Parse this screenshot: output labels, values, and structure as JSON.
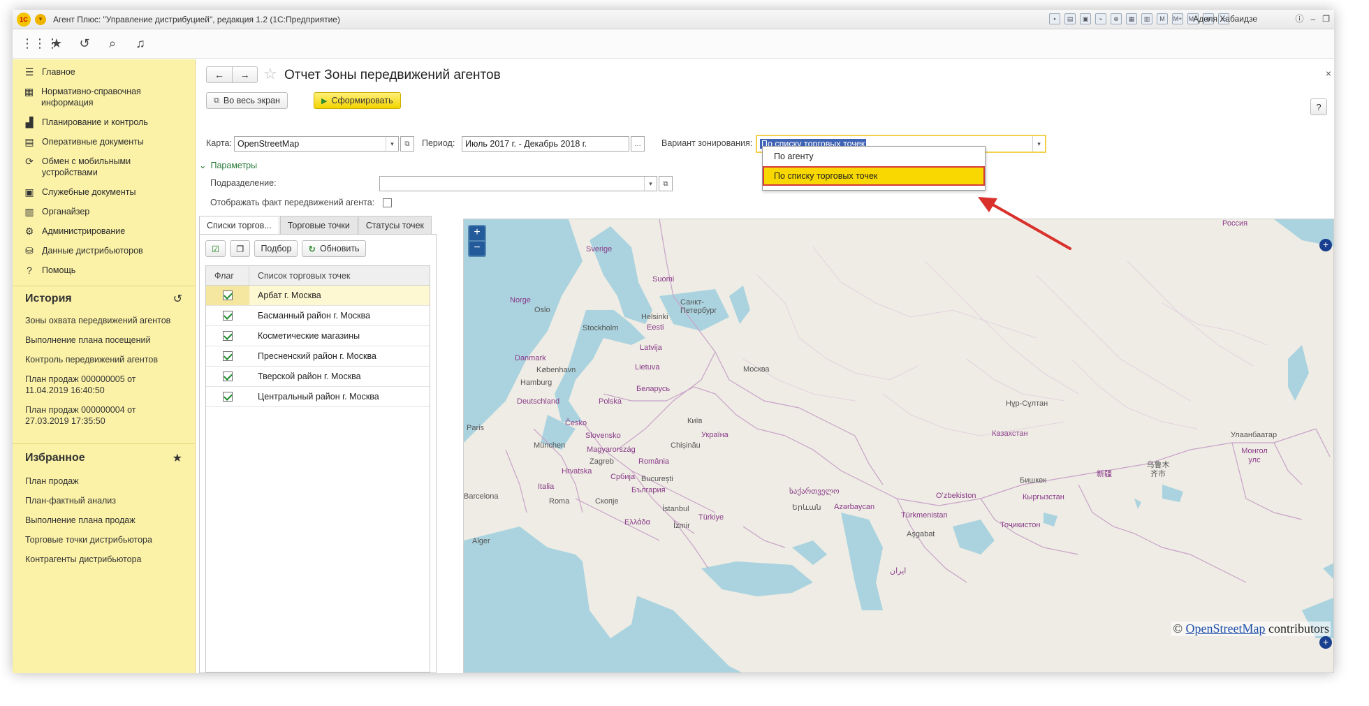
{
  "titlebar": {
    "title": "Агент Плюс: \"Управление дистрибуцией\", редакция 1.2  (1С:Предприятие)",
    "user": "Аделя Хабаидзе"
  },
  "sidebar": {
    "items": [
      {
        "label": "Главное",
        "icon": "menu-icon"
      },
      {
        "label": "Нормативно-справочная информация",
        "icon": "grid-icon"
      },
      {
        "label": "Планирование и контроль",
        "icon": "chart-icon"
      },
      {
        "label": "Оперативные документы",
        "icon": "documents-icon"
      },
      {
        "label": "Обмен с мобильными устройствами",
        "icon": "sync-icon"
      },
      {
        "label": "Служебные документы",
        "icon": "service-docs-icon"
      },
      {
        "label": "Органайзер",
        "icon": "organizer-icon"
      },
      {
        "label": "Администрирование",
        "icon": "gear-icon"
      },
      {
        "label": "Данные дистрибьюторов",
        "icon": "distributor-icon"
      },
      {
        "label": "Помощь",
        "icon": "question-icon"
      }
    ],
    "history_title": "История",
    "history": [
      "Зоны охвата передвижений агентов",
      "Выполнение плана посещений",
      "Контроль передвижений агентов",
      "План продаж 000000005 от 11.04.2019 16:40:50",
      "План продаж 000000004 от 27.03.2019 17:35:50"
    ],
    "favorites_title": "Избранное",
    "favorites": [
      "План продаж",
      "План-фактный анализ",
      "Выполнение плана продаж",
      "Торговые точки дистрибьютора",
      "Контрагенты дистрибьютора"
    ]
  },
  "main": {
    "title": "Отчет Зоны передвижений агентов",
    "fullscreen_label": "Во весь экран",
    "generate_label": "Сформировать",
    "help_label": "?",
    "map_label": "Карта:",
    "map_value": "OpenStreetMap",
    "period_label": "Период:",
    "period_value": "Июль 2017 г. - Декабрь 2018 г.",
    "zoning_label": "Вариант зонирования:",
    "zoning_value": "По списку торговых точек",
    "params_label": "Параметры",
    "division_label": "Подразделение:",
    "division_value": "",
    "show_fact_label": "Отображать факт передвижений агента:",
    "dropdown_options": [
      "По агенту",
      "По списку торговых точек"
    ]
  },
  "tabs": [
    "Списки торгов...",
    "Торговые точки",
    "Статусы точек"
  ],
  "list_toolbar": {
    "pick_label": "Подбор",
    "refresh_label": "Обновить"
  },
  "table": {
    "headers": [
      "Флаг",
      "Список торговых точек"
    ],
    "rows": [
      {
        "checked": true,
        "name": "Арбат г. Москва"
      },
      {
        "checked": true,
        "name": "Басманный район г. Москва"
      },
      {
        "checked": true,
        "name": "Косметические магазины"
      },
      {
        "checked": true,
        "name": "Пресненский район г. Москва"
      },
      {
        "checked": true,
        "name": "Тверской район г. Москва"
      },
      {
        "checked": true,
        "name": "Центральный район г. Москва"
      }
    ]
  },
  "map": {
    "labels": {
      "russia": "Россия",
      "sverige": "Sverige",
      "suomi": "Suomi",
      "norge": "Norge",
      "oslo": "Oslo",
      "stockholm": "Stockholm",
      "helsinki": "Helsinki",
      "spb": "Санкт-Петербург",
      "eesti": "Eesti",
      "latvija": "Latvija",
      "danmark": "Danmark",
      "kobenhavn": "København",
      "lietuva": "Lietuva",
      "moskva": "Москва",
      "hamburg": "Hamburg",
      "belarus": "Беларусь",
      "deutschland": "Deutschland",
      "polska": "Polska",
      "cesko": "Česko",
      "kyiv": "Київ",
      "paris": "Paris",
      "ukraina": "Україна",
      "slovensko": "Slovensko",
      "munchen": "München",
      "chisinau": "Chișinău",
      "magyar": "Magyarország",
      "zagreb": "Zagreb",
      "romania": "România",
      "hrvatska": "Hrvatska",
      "srbija": "Србија",
      "bucuresti": "București",
      "italia": "Italia",
      "bulgaria": "България",
      "roma": "Roma",
      "skopje": "Скопје",
      "istanbul": "İstanbul",
      "turkiye": "Türkiye",
      "ellada": "Ελλάδα",
      "izmir": "İzmir",
      "kazakhstan": "Казахстан",
      "nursultan": "Нұр-Сұлтан",
      "ulaanbaatar": "Улаанбаатар",
      "mongol": "Монгол улс",
      "uzbekiston": "Oʻzbekiston",
      "kyrgyzstan": "Кыргызстан",
      "turkmenistan": "Türkmenistan",
      "tajikistan": "Тоҷикистон",
      "ashgabat": "Aşgabat",
      "azerbaycan": "Azərbaycan",
      "bishkek": "Бишкек",
      "sakartvelo": "საქართველო",
      "yerevan": "Երևան",
      "barcelona": "Barcelona",
      "alger": "Alger",
      "iran": "ایران",
      "xinjiang": "新疆",
      "urumqi": "乌鲁木齐市",
      "attrib_prefix": "©",
      "attrib_link": "OpenStreetMap",
      "attrib_suffix": "contributors"
    }
  }
}
